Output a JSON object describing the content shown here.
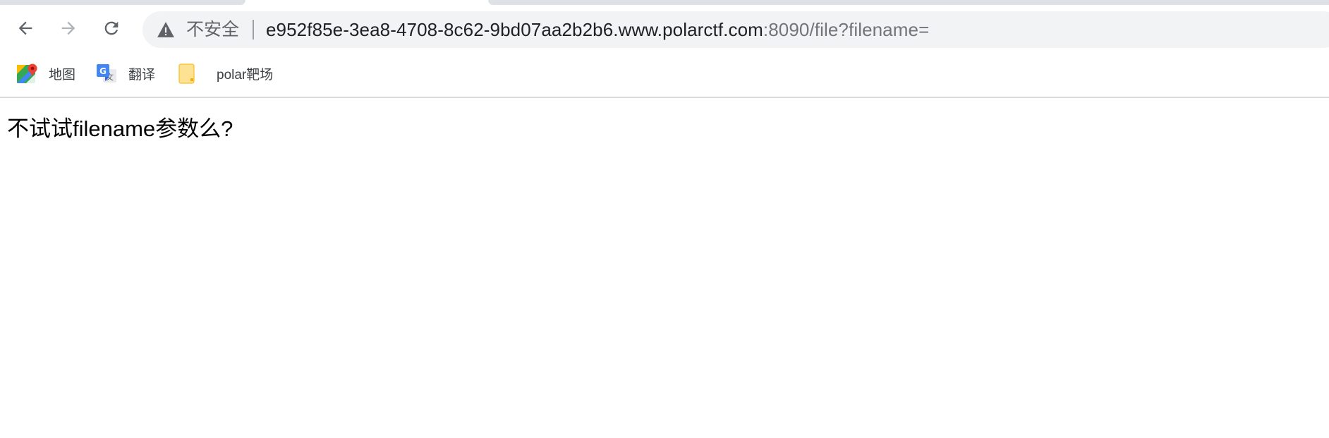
{
  "browser": {
    "nav": {
      "back_icon": "arrow-left-icon",
      "forward_icon": "arrow-right-icon",
      "reload_icon": "reload-icon"
    },
    "omnibox": {
      "security_icon": "warning-triangle-icon",
      "security_label": "不安全",
      "url_host": "e952f85e-3ea8-4708-8c62-9bd07aa2b2b6.www.polarctf.com",
      "url_rest": ":8090/file?filename="
    },
    "bookmarks": [
      {
        "label": "地图",
        "icon": "google-maps-icon"
      },
      {
        "label": "翻译",
        "icon": "google-translate-icon"
      },
      {
        "label": "polar靶场",
        "icon": "folder-icon"
      }
    ]
  },
  "page": {
    "message": "不试试filename参数么?"
  },
  "colors": {
    "toolbar_bg": "#ffffff",
    "omnibox_bg": "#f1f3f4",
    "tab_strip": "#dee1e6",
    "icon_gray": "#5f6368",
    "icon_disabled": "#b0b3b8",
    "url_host": "#202124",
    "url_rest": "#70757a",
    "bookmark_text": "#3c4043",
    "divider": "#dadce0"
  }
}
